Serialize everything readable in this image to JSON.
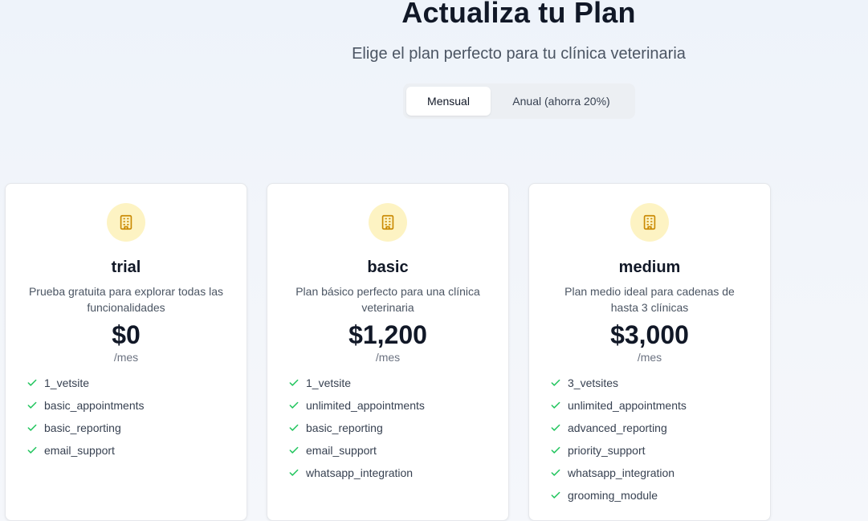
{
  "header": {
    "title": "Actualiza tu Plan",
    "subtitle": "Elige el plan perfecto para tu clínica veterinaria"
  },
  "billing_toggle": {
    "monthly_label": "Mensual",
    "annual_label": "Anual (ahorra 20%)",
    "selected": "Mensual"
  },
  "colors": {
    "icon_bg": "#fdf3c3",
    "icon_stroke": "#ca8a04",
    "check": "#22c55e"
  },
  "plans": [
    {
      "name": "trial",
      "description": "Prueba gratuita para explorar todas las funcionalidades",
      "price": "$0",
      "period": "/mes",
      "icon": "building-icon",
      "features": [
        "1_vetsite",
        "basic_appointments",
        "basic_reporting",
        "email_support"
      ]
    },
    {
      "name": "basic",
      "description": "Plan básico perfecto para una clínica veterinaria",
      "price": "$1,200",
      "period": "/mes",
      "icon": "building-icon",
      "features": [
        "1_vetsite",
        "unlimited_appointments",
        "basic_reporting",
        "email_support",
        "whatsapp_integration"
      ]
    },
    {
      "name": "medium",
      "description": "Plan medio ideal para cadenas de hasta 3 clínicas",
      "price": "$3,000",
      "period": "/mes",
      "icon": "building-icon",
      "features": [
        "3_vetsites",
        "unlimited_appointments",
        "advanced_reporting",
        "priority_support",
        "whatsapp_integration",
        "grooming_module"
      ]
    }
  ]
}
